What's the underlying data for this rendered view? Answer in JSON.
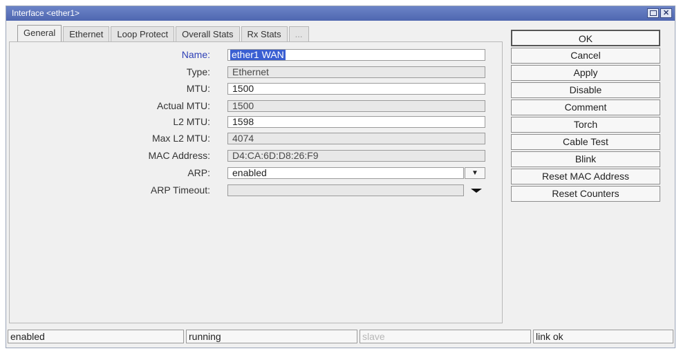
{
  "window": {
    "title": "Interface <ether1>"
  },
  "tabs": [
    "General",
    "Ethernet",
    "Loop Protect",
    "Overall Stats",
    "Rx Stats",
    "..."
  ],
  "form": {
    "name": {
      "label": "Name:",
      "value": "ether1 WAN"
    },
    "type": {
      "label": "Type:",
      "value": "Ethernet"
    },
    "mtu": {
      "label": "MTU:",
      "value": "1500"
    },
    "actual_mtu": {
      "label": "Actual MTU:",
      "value": "1500"
    },
    "l2_mtu": {
      "label": "L2 MTU:",
      "value": "1598"
    },
    "max_l2_mtu": {
      "label": "Max L2 MTU:",
      "value": "4074"
    },
    "mac_address": {
      "label": "MAC Address:",
      "value": "D4:CA:6D:D8:26:F9"
    },
    "arp": {
      "label": "ARP:",
      "value": "enabled"
    },
    "arp_timeout": {
      "label": "ARP Timeout:",
      "value": ""
    }
  },
  "buttons": {
    "ok": "OK",
    "cancel": "Cancel",
    "apply": "Apply",
    "disable": "Disable",
    "comment": "Comment",
    "torch": "Torch",
    "cable_test": "Cable Test",
    "blink": "Blink",
    "reset_mac": "Reset MAC Address",
    "reset_counters": "Reset Counters"
  },
  "status": {
    "enabled": "enabled",
    "running": "running",
    "slave": "slave",
    "link": "link ok"
  },
  "icons": {
    "maximize": "maximize-icon",
    "close": "close-icon",
    "dropdown": "chevron-down-icon"
  },
  "colors": {
    "titlebar": "#5a72bb",
    "label_focus": "#2d3fb6",
    "selection": "#3a5fd2"
  }
}
